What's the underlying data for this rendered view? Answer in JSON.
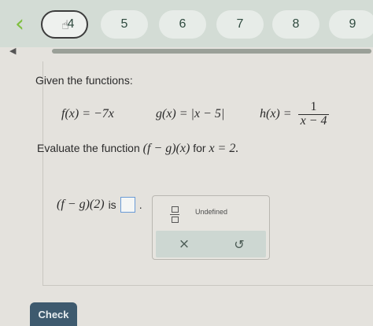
{
  "nav": {
    "back_glyph": "‹",
    "questions": [
      "4",
      "5",
      "6",
      "7",
      "8",
      "9"
    ],
    "current_index": 0
  },
  "prompt": "Given the functions:",
  "functions": {
    "f": "f(x) = −7x",
    "g": "g(x) = |x − 5|",
    "h_lhs": "h(x) =",
    "h_num": "1",
    "h_den": "x − 4"
  },
  "evaluate": {
    "prefix": "Evaluate the function",
    "expr": "(f − g)(x)",
    "for_word": "for",
    "condition": "x = 2."
  },
  "answer": {
    "expr": "(f − g)(2)",
    "is_word": "is",
    "value": "",
    "trailing": "."
  },
  "palette": {
    "undefined_label": "Undefined",
    "clear_glyph": "×",
    "undo_glyph": "↺"
  },
  "check_label": "Check",
  "colors": {
    "nav_bg": "#d3dcd5",
    "back_arrow": "#7fbf3f",
    "check_bg": "#3e5a6e",
    "answer_box_border": "#6a9bd6"
  }
}
